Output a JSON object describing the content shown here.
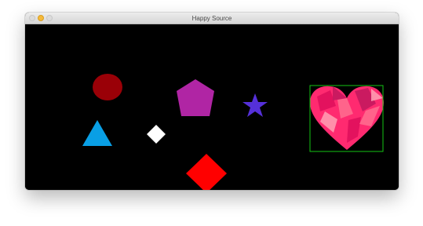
{
  "window": {
    "title": "Happy Source",
    "traffic_lights": {
      "close_color": "#dcdcdc",
      "minimize_color": "#f5b93a",
      "zoom_color": "#dcdcdc"
    }
  },
  "canvas": {
    "background": "#000000",
    "shapes": [
      {
        "kind": "ellipse",
        "color": "#9a0007"
      },
      {
        "kind": "pentagon",
        "color": "#b025a4"
      },
      {
        "kind": "star",
        "color": "#5530d9"
      },
      {
        "kind": "triangle",
        "color": "#099fe5"
      },
      {
        "kind": "diamond-small",
        "color": "#ffffff"
      },
      {
        "kind": "diamond-large",
        "color": "#ff0000"
      },
      {
        "kind": "heart",
        "colors": [
          "#ff2a70",
          "#e0105c",
          "#ff6a8e",
          "#c4185e",
          "#ff9ab0"
        ],
        "selected": true,
        "selection_color": "#13c513"
      }
    ]
  }
}
